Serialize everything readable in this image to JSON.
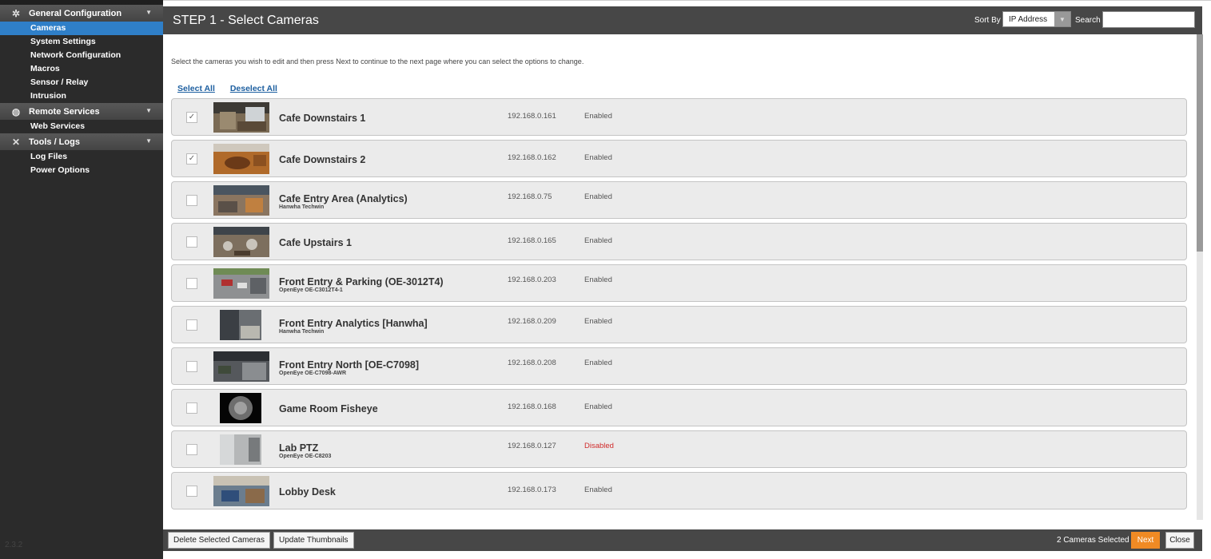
{
  "sidebar": {
    "sections": [
      {
        "label": "General Configuration",
        "icon": "gear-icon",
        "items": [
          "Cameras",
          "System Settings",
          "Network Configuration",
          "Macros",
          "Sensor / Relay",
          "Intrusion"
        ]
      },
      {
        "label": "Remote Services",
        "icon": "globe-icon",
        "items": [
          "Web Services"
        ]
      },
      {
        "label": "Tools / Logs",
        "icon": "tools-icon",
        "items": [
          "Log Files",
          "Power Options"
        ]
      }
    ],
    "active_item": "Cameras",
    "version": "2.3.2"
  },
  "header": {
    "title": "STEP 1 - Select Cameras",
    "sort_by_label": "Sort By",
    "sort_value": "IP Address",
    "search_label": "Search",
    "search_value": ""
  },
  "instructions": "Select the cameras you wish to edit and then press Next to continue to the next page where you can select the options to change.",
  "links": {
    "select_all": "Select All",
    "deselect_all": "Deselect All"
  },
  "cameras": [
    {
      "name": "Cafe Downstairs 1",
      "sub": "",
      "ip": "192.168.0.161",
      "status": "Enabled",
      "checked": true
    },
    {
      "name": "Cafe Downstairs 2",
      "sub": "",
      "ip": "192.168.0.162",
      "status": "Enabled",
      "checked": true
    },
    {
      "name": "Cafe Entry Area (Analytics)",
      "sub": "Hanwha Techwin",
      "ip": "192.168.0.75",
      "status": "Enabled",
      "checked": false
    },
    {
      "name": "Cafe Upstairs 1",
      "sub": "",
      "ip": "192.168.0.165",
      "status": "Enabled",
      "checked": false
    },
    {
      "name": "Front Entry & Parking (OE-3012T4)",
      "sub": "OpenEye OE-C3012T4-1",
      "ip": "192.168.0.203",
      "status": "Enabled",
      "checked": false
    },
    {
      "name": "Front Entry Analytics [Hanwha]",
      "sub": "Hanwha Techwin",
      "ip": "192.168.0.209",
      "status": "Enabled",
      "checked": false
    },
    {
      "name": "Front Entry North [OE-C7098]",
      "sub": "OpenEye OE-C7098-AWR",
      "ip": "192.168.0.208",
      "status": "Enabled",
      "checked": false
    },
    {
      "name": "Game Room Fisheye",
      "sub": "",
      "ip": "192.168.0.168",
      "status": "Enabled",
      "checked": false
    },
    {
      "name": "Lab PTZ",
      "sub": "OpenEye OE-C8203",
      "ip": "192.168.0.127",
      "status": "Disabled",
      "checked": false
    },
    {
      "name": "Lobby Desk",
      "sub": "",
      "ip": "192.168.0.173",
      "status": "Enabled",
      "checked": false
    }
  ],
  "footer": {
    "delete_label": "Delete Selected Cameras",
    "update_label": "Update Thumbnails",
    "selected_text": "2 Cameras Selected",
    "next_label": "Next",
    "close_label": "Close"
  },
  "colors": {
    "accent_blue": "#2f7fc8",
    "next_orange": "#f08a24",
    "disabled_red": "#d02b2b",
    "header_bg": "#474747"
  }
}
